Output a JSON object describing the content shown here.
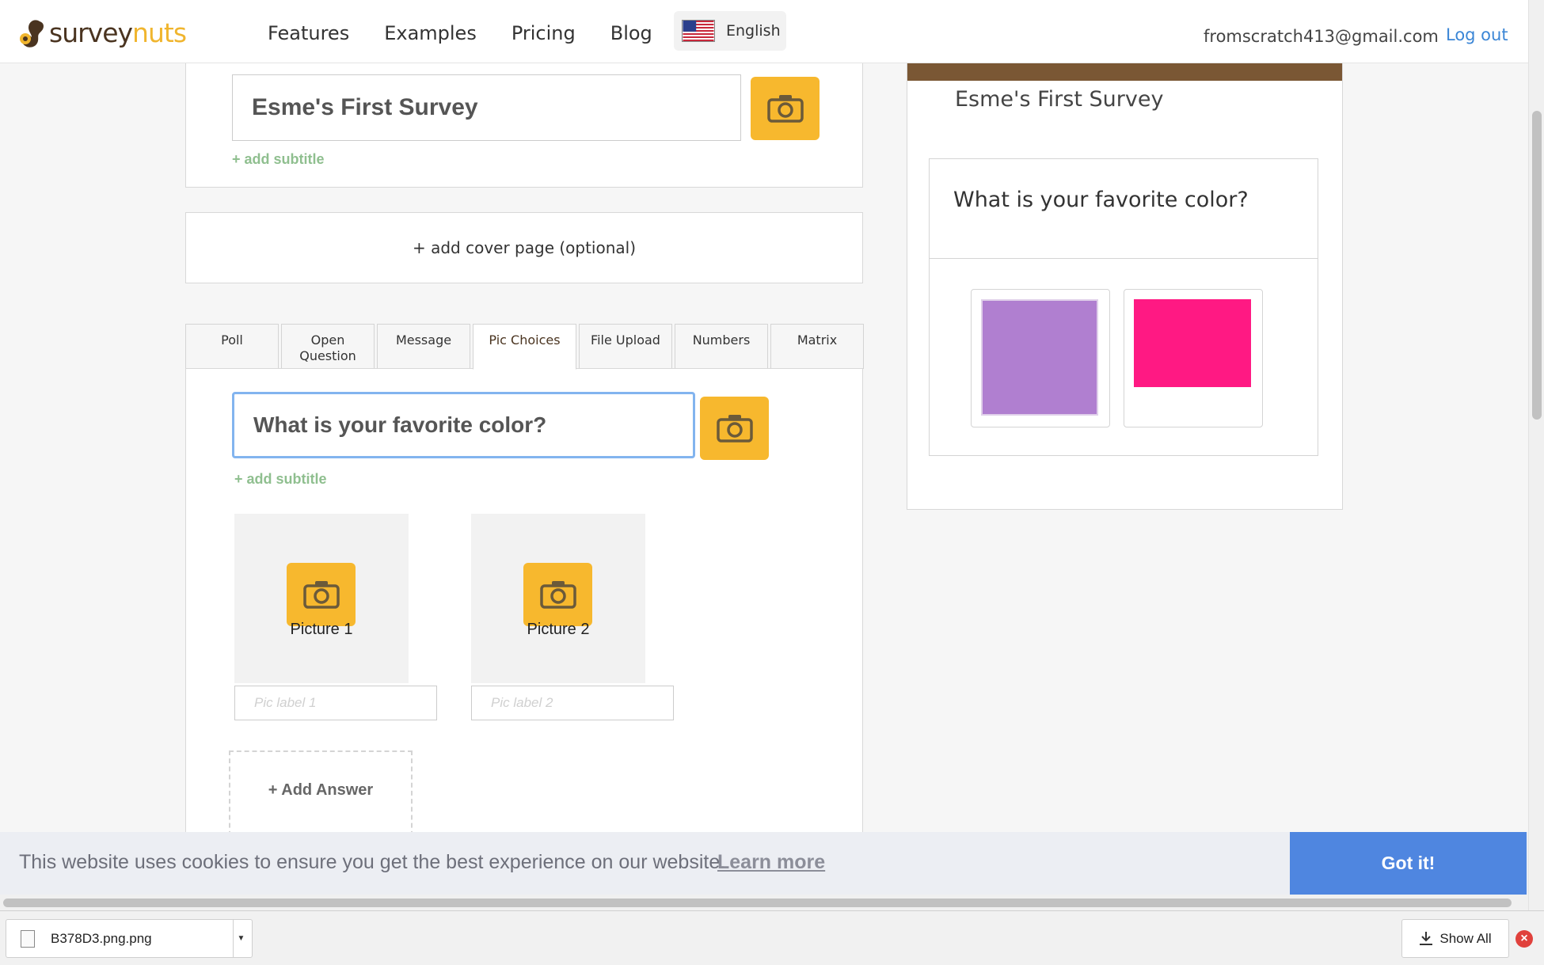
{
  "header": {
    "logo_part1": "survey",
    "logo_part2": "nuts",
    "nav": [
      "Features",
      "Examples",
      "Pricing",
      "Blog"
    ],
    "language": "English",
    "email": "fromscratch413@gmail.com",
    "logout": "Log out"
  },
  "editor": {
    "survey_title": "Esme's First Survey",
    "add_subtitle": "+ add subtitle",
    "add_cover": "+ add cover page (optional)",
    "tabs": [
      "Poll",
      "Open Question",
      "Message",
      "Pic Choices",
      "File Upload",
      "Numbers",
      "Matrix"
    ],
    "active_tab": "Pic Choices",
    "question": "What is your favorite color?",
    "question_add_subtitle": "+ add subtitle",
    "pictures": [
      {
        "label": "Picture 1",
        "placeholder": "Pic label 1"
      },
      {
        "label": "Picture 2",
        "placeholder": "Pic label 2"
      }
    ],
    "add_answer": "+ Add Answer"
  },
  "preview": {
    "title": "Esme's First Survey",
    "question": "What is your favorite color?",
    "swatch_colors": [
      "#b07fd0",
      "#ff1983"
    ],
    "header_bar_color": "#7a5734"
  },
  "cookie": {
    "message": "This website uses cookies to ensure you get the best experience on our website.",
    "learn_more": "Learn more",
    "button": "Got it!"
  },
  "download_shelf": {
    "file_name": "B378D3.png.png",
    "show_all": "Show All"
  },
  "colors": {
    "accent": "#f7b82e",
    "brand_dark": "#4a3420",
    "link": "#3b86d6",
    "cookie_button": "#4f86e0"
  }
}
